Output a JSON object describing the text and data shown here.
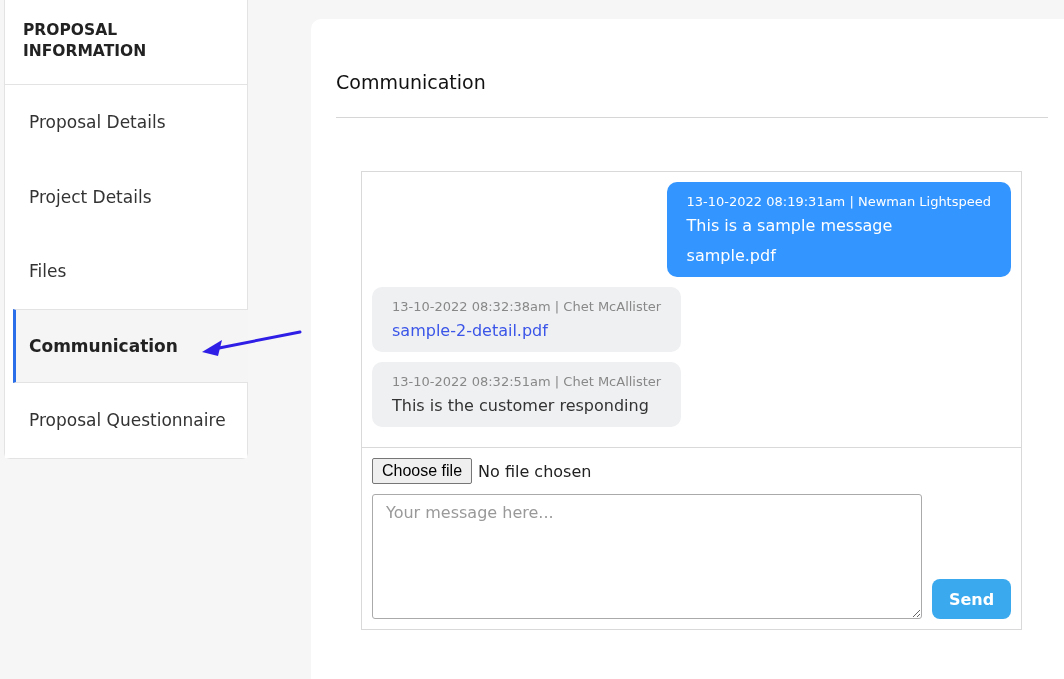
{
  "sidebar": {
    "title": "PROPOSAL INFORMATION",
    "items": [
      {
        "label": "Proposal Details",
        "selected": false
      },
      {
        "label": "Project Details",
        "selected": false
      },
      {
        "label": "Files",
        "selected": false
      },
      {
        "label": "Communication",
        "selected": true
      },
      {
        "label": "Proposal Questionnaire",
        "selected": false
      }
    ]
  },
  "main": {
    "title": "Communication",
    "messages": [
      {
        "kind": "sent",
        "meta": "13-10-2022 08:19:31am | Newman Lightspeed",
        "lines": [
          {
            "kind": "text",
            "text": "This is a sample message"
          },
          {
            "kind": "file",
            "text": "sample.pdf"
          }
        ]
      },
      {
        "kind": "received",
        "meta": "13-10-2022 08:32:38am | Chet McAllister",
        "lines": [
          {
            "kind": "file",
            "text": "sample-2-detail.pdf"
          }
        ]
      },
      {
        "kind": "received",
        "meta": "13-10-2022 08:32:51am | Chet McAllister",
        "lines": [
          {
            "kind": "text",
            "text": "This is the customer responding"
          }
        ]
      }
    ],
    "file_input": {
      "button": "Choose file",
      "status": "No file chosen"
    },
    "message_field": {
      "placeholder": "Your message here..."
    },
    "send_button": "Send"
  }
}
